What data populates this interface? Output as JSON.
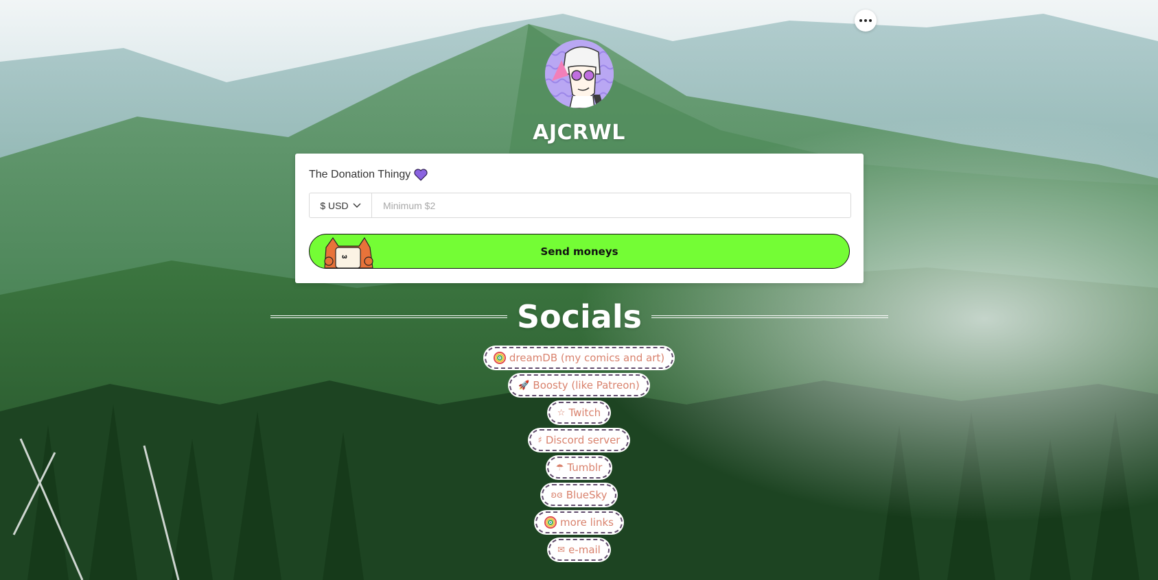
{
  "profile": {
    "name": "AJCRWL"
  },
  "donation": {
    "title": "The Donation Thingy",
    "currency_label": "$ USD",
    "amount_placeholder": "Minimum $2",
    "amount_value": "",
    "send_label": "Send moneys"
  },
  "socials": {
    "title": "Socials",
    "links": [
      {
        "label": "dreamDB (my comics and art)",
        "icon": "dreamdb-icon"
      },
      {
        "label": "Boosty (like Patreon)",
        "icon": "rocket-icon"
      },
      {
        "label": "Twitch",
        "icon": "star-icon"
      },
      {
        "label": "Discord server",
        "icon": "hash-icon"
      },
      {
        "label": "Tumblr",
        "icon": "umbrella-icon"
      },
      {
        "label": "BlueSky",
        "icon": "butterfly-icon"
      },
      {
        "label": "more links",
        "icon": "dreamdb-icon"
      },
      {
        "label": "e-mail",
        "icon": "envelope-icon"
      }
    ]
  },
  "colors": {
    "send_button": "#74fd35",
    "link_text": "#d9826d",
    "link_border": "#5f4a6b",
    "heart": "#8a63e0"
  }
}
